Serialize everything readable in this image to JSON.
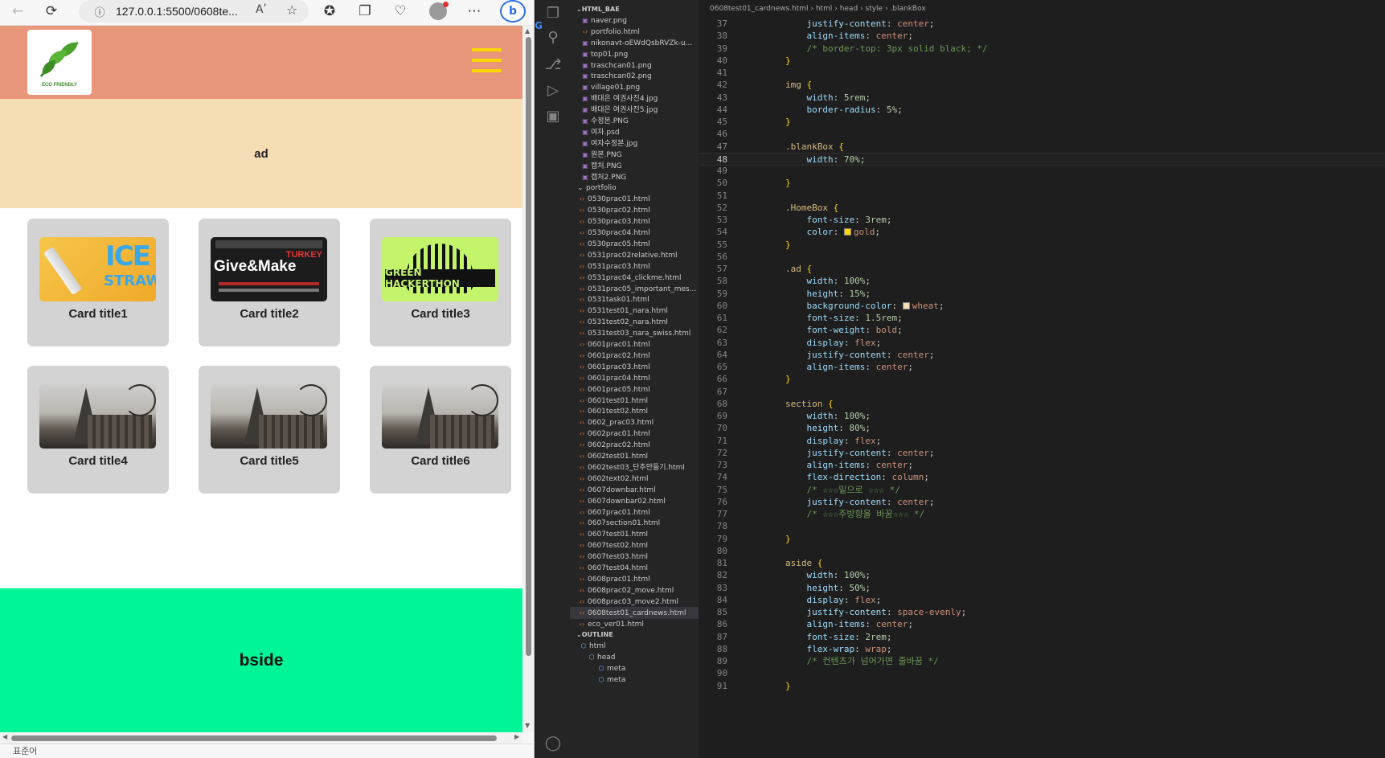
{
  "browser": {
    "url": "127.0.0.1:5500/0608te...",
    "read_aloud": "Aʹ",
    "status": "표준어"
  },
  "site": {
    "logo_text": "ECO FRIENDLY",
    "ad_label": "ad",
    "bside_label": "bside",
    "cards": [
      {
        "title": "Card title1",
        "thumb": "ice-straw",
        "thumb_word": "ICE",
        "thumb_word2": "STRAW"
      },
      {
        "title": "Card title2",
        "thumb": "give-make",
        "thumb_word": "Give&Make",
        "thumb_word2": "TURKEY"
      },
      {
        "title": "Card title3",
        "thumb": "hackathon",
        "thumb_word": "GREEN HACKERTHON"
      },
      {
        "title": "Card title4",
        "thumb": "paris"
      },
      {
        "title": "Card title5",
        "thumb": "paris"
      },
      {
        "title": "Card title6",
        "thumb": "paris"
      }
    ]
  },
  "explorer": {
    "root": "HTML_BAE",
    "files": [
      "naver.png",
      "portfolio.html",
      "nikonavt-oEWdQsbRVZk-u...",
      "top01.png",
      "traschcan01.png",
      "traschcan02.png",
      "village01.png",
      "배대은 여권사진4.jpg",
      "배대은 여권사진5.jpg",
      "수정본.PNG",
      "여자.psd",
      "여자수정본.jpg",
      "원본.PNG",
      "캡처.PNG",
      "캡처2.PNG"
    ],
    "folder": "portfolio",
    "portfolio_files": [
      "0530prac01.html",
      "0530prac02.html",
      "0530prac03.html",
      "0530prac04.html",
      "0530prac05.html",
      "0531prac02relative.html",
      "0531prac03.html",
      "0531prac04_clickme.html",
      "0531prac05_important_mes...",
      "0531task01.html",
      "0531test01_nara.html",
      "0531test02_nara.html",
      "0531test03_nara_swiss.html",
      "0601prac01.html",
      "0601prac02.html",
      "0601prac03.html",
      "0601prac04.html",
      "0601prac05.html",
      "0601test01.html",
      "0601test02.html",
      "0602_prac03.html",
      "0602prac01.html",
      "0602prac02.html",
      "0602test01.html",
      "0602test03_단추만들기.html",
      "0602text02.html",
      "0607downbar.html",
      "0607downbar02.html",
      "0607prac01.html",
      "0607section01.html",
      "0607test01.html",
      "0607test02.html",
      "0607test03.html",
      "0607test04.html",
      "0608prac01.html",
      "0608prac02_move.html",
      "0608prac03_move2.html",
      "0608test01_cardnews.html",
      "eco_ver01.html"
    ],
    "selected": "0608test01_cardnews.html",
    "outline_title": "OUTLINE",
    "outline": [
      "html",
      "head",
      "meta",
      "meta"
    ]
  },
  "editor": {
    "breadcrumb": [
      "0608test01_cardnews.html",
      "html",
      "head",
      "style",
      ".blankBox"
    ],
    "current_line": 48,
    "lines": [
      {
        "n": 37,
        "code": "    justify-content: center;",
        "t": "decl",
        "p": "justify-content",
        "v": "center"
      },
      {
        "n": 38,
        "code": "    align-items: center;",
        "t": "decl",
        "p": "align-items",
        "v": "center"
      },
      {
        "n": 39,
        "code": "    /* border-top: 3px solid black; */",
        "t": "comment"
      },
      {
        "n": 40,
        "code": "}",
        "t": "close"
      },
      {
        "n": 41,
        "code": "",
        "t": "blank"
      },
      {
        "n": 42,
        "code": "img {",
        "t": "sel",
        "s": "img"
      },
      {
        "n": 43,
        "code": "    width: 5rem;",
        "t": "decl",
        "p": "width",
        "v": "5rem"
      },
      {
        "n": 44,
        "code": "    border-radius: 5%;",
        "t": "decl",
        "p": "border-radius",
        "v": "5%"
      },
      {
        "n": 45,
        "code": "}",
        "t": "close"
      },
      {
        "n": 46,
        "code": "",
        "t": "blank"
      },
      {
        "n": 47,
        "code": ".blankBox {",
        "t": "sel",
        "s": ".blankBox"
      },
      {
        "n": 48,
        "code": "    width: 70%;",
        "t": "decl",
        "p": "width",
        "v": "70%"
      },
      {
        "n": 49,
        "code": "",
        "t": "blank"
      },
      {
        "n": 50,
        "code": "}",
        "t": "close"
      },
      {
        "n": 51,
        "code": "",
        "t": "blank"
      },
      {
        "n": 52,
        "code": ".HomeBox {",
        "t": "sel",
        "s": ".HomeBox"
      },
      {
        "n": 53,
        "code": "    font-size: 3rem;",
        "t": "decl",
        "p": "font-size",
        "v": "3rem"
      },
      {
        "n": 54,
        "code": "    color: gold;",
        "t": "decl",
        "p": "color",
        "v": "gold",
        "swatch": "#ffd700"
      },
      {
        "n": 55,
        "code": "}",
        "t": "close"
      },
      {
        "n": 56,
        "code": "",
        "t": "blank"
      },
      {
        "n": 57,
        "code": ".ad {",
        "t": "sel",
        "s": ".ad"
      },
      {
        "n": 58,
        "code": "    width: 100%;",
        "t": "decl",
        "p": "width",
        "v": "100%"
      },
      {
        "n": 59,
        "code": "    height: 15%;",
        "t": "decl",
        "p": "height",
        "v": "15%"
      },
      {
        "n": 60,
        "code": "    background-color: wheat;",
        "t": "decl",
        "p": "background-color",
        "v": "wheat",
        "swatch": "#f5deb3"
      },
      {
        "n": 61,
        "code": "    font-size: 1.5rem;",
        "t": "decl",
        "p": "font-size",
        "v": "1.5rem"
      },
      {
        "n": 62,
        "code": "    font-weight: bold;",
        "t": "decl",
        "p": "font-weight",
        "v": "bold"
      },
      {
        "n": 63,
        "code": "    display: flex;",
        "t": "decl",
        "p": "display",
        "v": "flex"
      },
      {
        "n": 64,
        "code": "    justify-content: center;",
        "t": "decl",
        "p": "justify-content",
        "v": "center"
      },
      {
        "n": 65,
        "code": "    align-items: center;",
        "t": "decl",
        "p": "align-items",
        "v": "center"
      },
      {
        "n": 66,
        "code": "}",
        "t": "close"
      },
      {
        "n": 67,
        "code": "",
        "t": "blank"
      },
      {
        "n": 68,
        "code": "section {",
        "t": "sel",
        "s": "section"
      },
      {
        "n": 69,
        "code": "    width: 100%;",
        "t": "decl",
        "p": "width",
        "v": "100%"
      },
      {
        "n": 70,
        "code": "    height: 80%;",
        "t": "decl",
        "p": "height",
        "v": "80%"
      },
      {
        "n": 71,
        "code": "    display: flex;",
        "t": "decl",
        "p": "display",
        "v": "flex"
      },
      {
        "n": 72,
        "code": "    justify-content: center;",
        "t": "decl",
        "p": "justify-content",
        "v": "center"
      },
      {
        "n": 73,
        "code": "    align-items: center;",
        "t": "decl",
        "p": "align-items",
        "v": "center"
      },
      {
        "n": 74,
        "code": "    flex-direction: column;",
        "t": "decl",
        "p": "flex-direction",
        "v": "column"
      },
      {
        "n": 75,
        "code": "    /* ☆☆☆밑으로 ☆☆☆ */",
        "t": "comment"
      },
      {
        "n": 76,
        "code": "    justify-content: center;",
        "t": "decl",
        "p": "justify-content",
        "v": "center"
      },
      {
        "n": 77,
        "code": "    /* ☆☆☆주방향을 바꿈☆☆☆ */",
        "t": "comment"
      },
      {
        "n": 78,
        "code": "",
        "t": "blank"
      },
      {
        "n": 79,
        "code": "}",
        "t": "close"
      },
      {
        "n": 80,
        "code": "",
        "t": "blank"
      },
      {
        "n": 81,
        "code": "aside {",
        "t": "sel",
        "s": "aside"
      },
      {
        "n": 82,
        "code": "    width: 100%;",
        "t": "decl",
        "p": "width",
        "v": "100%"
      },
      {
        "n": 83,
        "code": "    height: 50%;",
        "t": "decl",
        "p": "height",
        "v": "50%"
      },
      {
        "n": 84,
        "code": "    display: flex;",
        "t": "decl",
        "p": "display",
        "v": "flex"
      },
      {
        "n": 85,
        "code": "    justify-content: space-evenly;",
        "t": "decl",
        "p": "justify-content",
        "v": "space-evenly"
      },
      {
        "n": 86,
        "code": "    align-items: center;",
        "t": "decl",
        "p": "align-items",
        "v": "center"
      },
      {
        "n": 87,
        "code": "    font-size: 2rem;",
        "t": "decl",
        "p": "font-size",
        "v": "2rem"
      },
      {
        "n": 88,
        "code": "    flex-wrap: wrap;",
        "t": "decl",
        "p": "flex-wrap",
        "v": "wrap"
      },
      {
        "n": 89,
        "code": "    /* 컨텐츠가 넘어가면 줄바꿈 */",
        "t": "comment"
      },
      {
        "n": 90,
        "code": "",
        "t": "blank"
      },
      {
        "n": 91,
        "code": "}",
        "t": "close"
      }
    ]
  },
  "colors": {
    "header": "#e9977a",
    "ad": "#f5deb3",
    "bside": "#00f596",
    "card": "#d3d3d3",
    "hamburger": "#ffd700"
  },
  "icons": {
    "back": "arrow-left-icon",
    "reload": "reload-icon",
    "info": "info-icon",
    "favorite": "star-icon",
    "collections": "collections-icon",
    "extensions": "extensions-icon",
    "profile": "profile-icon",
    "more": "more-icon",
    "copilot": "bing-icon"
  }
}
